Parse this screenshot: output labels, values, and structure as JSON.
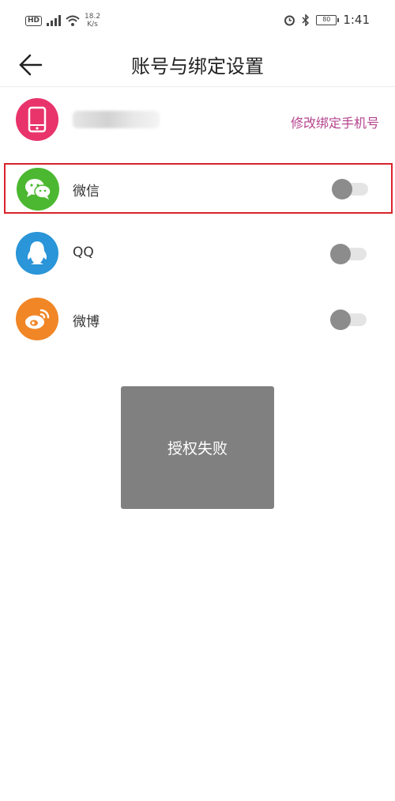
{
  "status_bar": {
    "hd_badge": "HD",
    "network_speed": "18.2",
    "speed_unit": "K/s",
    "battery": "80",
    "time": "1:41"
  },
  "header": {
    "title": "账号与绑定设置"
  },
  "phone_row": {
    "edit_link": "修改绑定手机号"
  },
  "bindings": {
    "wechat": {
      "label": "微信",
      "enabled": false
    },
    "qq": {
      "label": "QQ",
      "enabled": false
    },
    "weibo": {
      "label": "微博",
      "enabled": false
    }
  },
  "toast": {
    "message": "授权失败"
  },
  "colors": {
    "phone_icon_bg": "#e8336b",
    "wechat_icon_bg": "#4cb831",
    "qq_icon_bg": "#2a95d8",
    "weibo_icon_bg": "#f08626",
    "accent_link": "#b5448d",
    "highlight_border": "#d9232b",
    "toast_bg": "#808080"
  }
}
